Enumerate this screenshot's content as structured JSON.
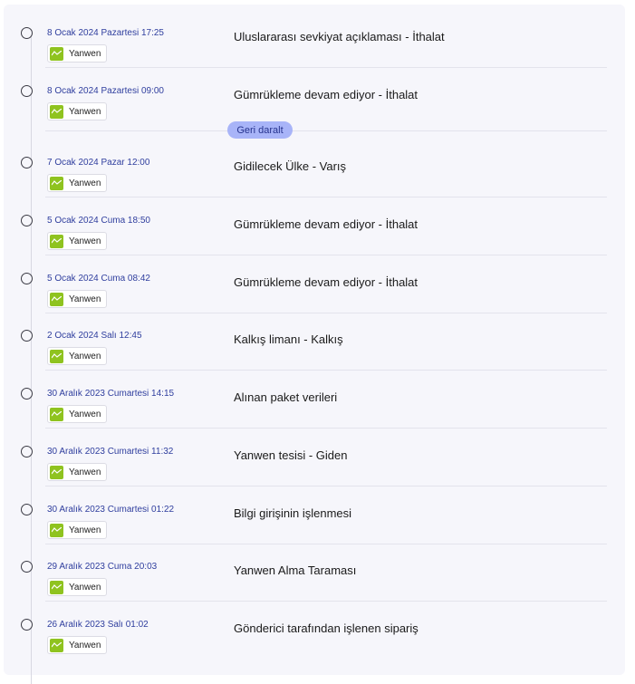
{
  "collapse": {
    "label": "Geri daralt"
  },
  "events": [
    {
      "date": "8 Ocak 2024 Pazartesi 17:25",
      "carrier": "Yanwen",
      "description": "Uluslararası sevkiyat açıklaması - İthalat"
    },
    {
      "date": "8 Ocak 2024 Pazartesi 09:00",
      "carrier": "Yanwen",
      "description": "Gümrükleme devam ediyor - İthalat"
    },
    {
      "date": "7 Ocak 2024 Pazar 12:00",
      "carrier": "Yanwen",
      "description": "Gidilecek Ülke - Varış"
    },
    {
      "date": "5 Ocak 2024 Cuma 18:50",
      "carrier": "Yanwen",
      "description": "Gümrükleme devam ediyor - İthalat"
    },
    {
      "date": "5 Ocak 2024 Cuma 08:42",
      "carrier": "Yanwen",
      "description": "Gümrükleme devam ediyor - İthalat"
    },
    {
      "date": "2 Ocak 2024 Salı 12:45",
      "carrier": "Yanwen",
      "description": "Kalkış limanı - Kalkış"
    },
    {
      "date": "30 Aralık 2023 Cumartesi 14:15",
      "carrier": "Yanwen",
      "description": "Alınan paket verileri"
    },
    {
      "date": "30 Aralık 2023 Cumartesi 11:32",
      "carrier": "Yanwen",
      "description": "Yanwen tesisi - Giden"
    },
    {
      "date": "30 Aralık 2023 Cumartesi 01:22",
      "carrier": "Yanwen",
      "description": "Bilgi girişinin işlenmesi"
    },
    {
      "date": "29 Aralık 2023 Cuma 20:03",
      "carrier": "Yanwen",
      "description": "Yanwen Alma Taraması"
    },
    {
      "date": "26 Aralık 2023 Salı 01:02",
      "carrier": "Yanwen",
      "description": "Gönderici tarafından işlenen sipariş"
    }
  ]
}
